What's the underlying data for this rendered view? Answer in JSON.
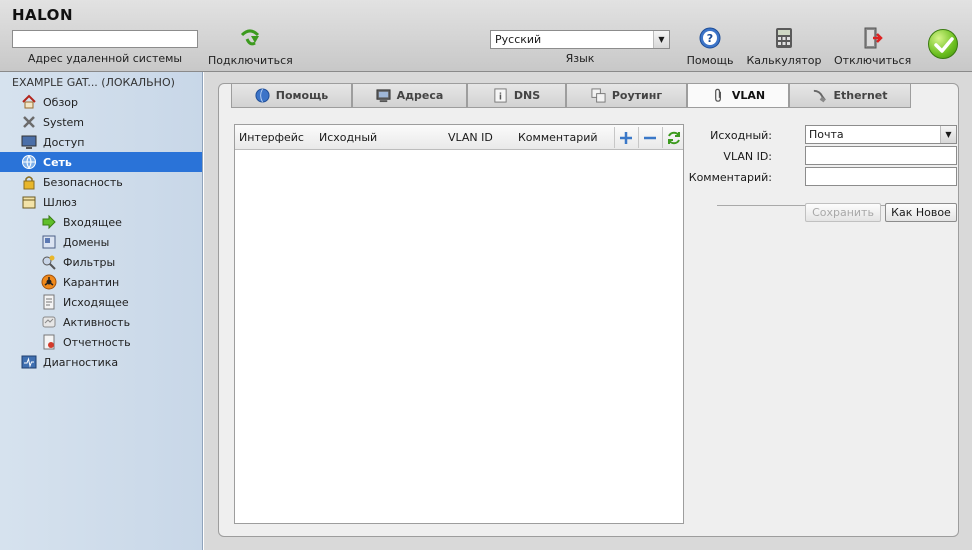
{
  "app": {
    "logo": "HALON"
  },
  "header": {
    "remote_caption": "Адрес удаленной системы",
    "remote_value": "",
    "connect_label": "Подключиться",
    "language_value": "Русский",
    "language_caption": "Язык",
    "help_label": "Помощь",
    "calculator_label": "Калькулятор",
    "disconnect_label": "Отключиться",
    "status_color": "#6bbf1f"
  },
  "sidebar": {
    "heading": "EXAMPLE GAT... (ЛОКАЛЬНО)",
    "items": [
      {
        "label": "Обзор",
        "icon": "home-icon"
      },
      {
        "label": "System",
        "icon": "tools-icon"
      },
      {
        "label": "Доступ",
        "icon": "monitor-icon"
      },
      {
        "label": "Сеть",
        "icon": "globe-icon",
        "active": true
      },
      {
        "label": "Безопасность",
        "icon": "lock-icon"
      },
      {
        "label": "Шлюз",
        "icon": "gateway-icon"
      },
      {
        "label": "Входящее",
        "icon": "arrow-right-icon"
      },
      {
        "label": "Домены",
        "icon": "domains-icon"
      },
      {
        "label": "Фильтры",
        "icon": "filters-icon"
      },
      {
        "label": "Карантин",
        "icon": "biohazard-icon"
      },
      {
        "label": "Исходящее",
        "icon": "outgoing-icon"
      },
      {
        "label": "Активность",
        "icon": "activity-icon"
      },
      {
        "label": "Отчетность",
        "icon": "report-icon"
      },
      {
        "label": "Диагностика",
        "icon": "diagnostics-icon"
      }
    ]
  },
  "tabs": [
    {
      "label": "Помощь",
      "icon": "help-globe-icon"
    },
    {
      "label": "Адреса",
      "icon": "monitor-icon"
    },
    {
      "label": "DNS",
      "icon": "dns-icon"
    },
    {
      "label": "Роутинг",
      "icon": "routing-icon"
    },
    {
      "label": "VLAN",
      "icon": "paperclip-icon",
      "active": true
    },
    {
      "label": "Ethernet",
      "icon": "cable-icon"
    }
  ],
  "grid": {
    "columns": [
      "Интерфейс",
      "Исходный",
      "VLAN ID",
      "Комментарий"
    ],
    "rows": []
  },
  "form": {
    "source_label": "Исходный:",
    "source_value": "Почта",
    "vlan_id_label": "VLAN ID:",
    "vlan_id_value": "",
    "comment_label": "Комментарий:",
    "comment_value": "",
    "save_label": "Сохранить",
    "save_as_new_label": "Как Новое"
  },
  "colors": {
    "accent": "#2a73d8",
    "sidebar_bg": "#d0dceb"
  }
}
